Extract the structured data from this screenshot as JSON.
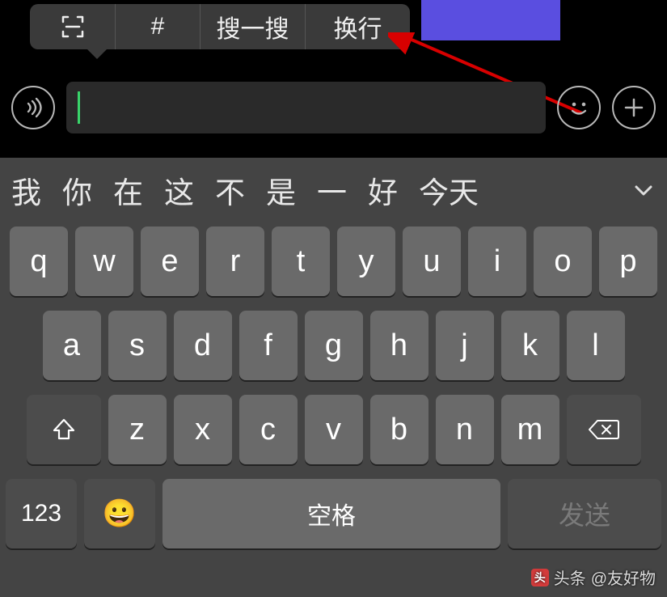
{
  "popup": {
    "scan_label": "⌷",
    "hash_label": "#",
    "search_label": "搜一搜",
    "newline_label": "换行"
  },
  "chat_input": {
    "value": ""
  },
  "candidates": {
    "items": [
      "我",
      "你",
      "在",
      "这",
      "不",
      "是",
      "一",
      "好",
      "今天"
    ]
  },
  "keyboard": {
    "row1": [
      "q",
      "w",
      "e",
      "r",
      "t",
      "y",
      "u",
      "i",
      "o",
      "p"
    ],
    "row2": [
      "a",
      "s",
      "d",
      "f",
      "g",
      "h",
      "j",
      "k",
      "l"
    ],
    "row3": [
      "z",
      "x",
      "c",
      "v",
      "b",
      "n",
      "m"
    ],
    "num_label": "123",
    "space_label": "空格",
    "send_label": "发送"
  },
  "watermark": {
    "prefix": "头条",
    "text": "@友好物"
  }
}
